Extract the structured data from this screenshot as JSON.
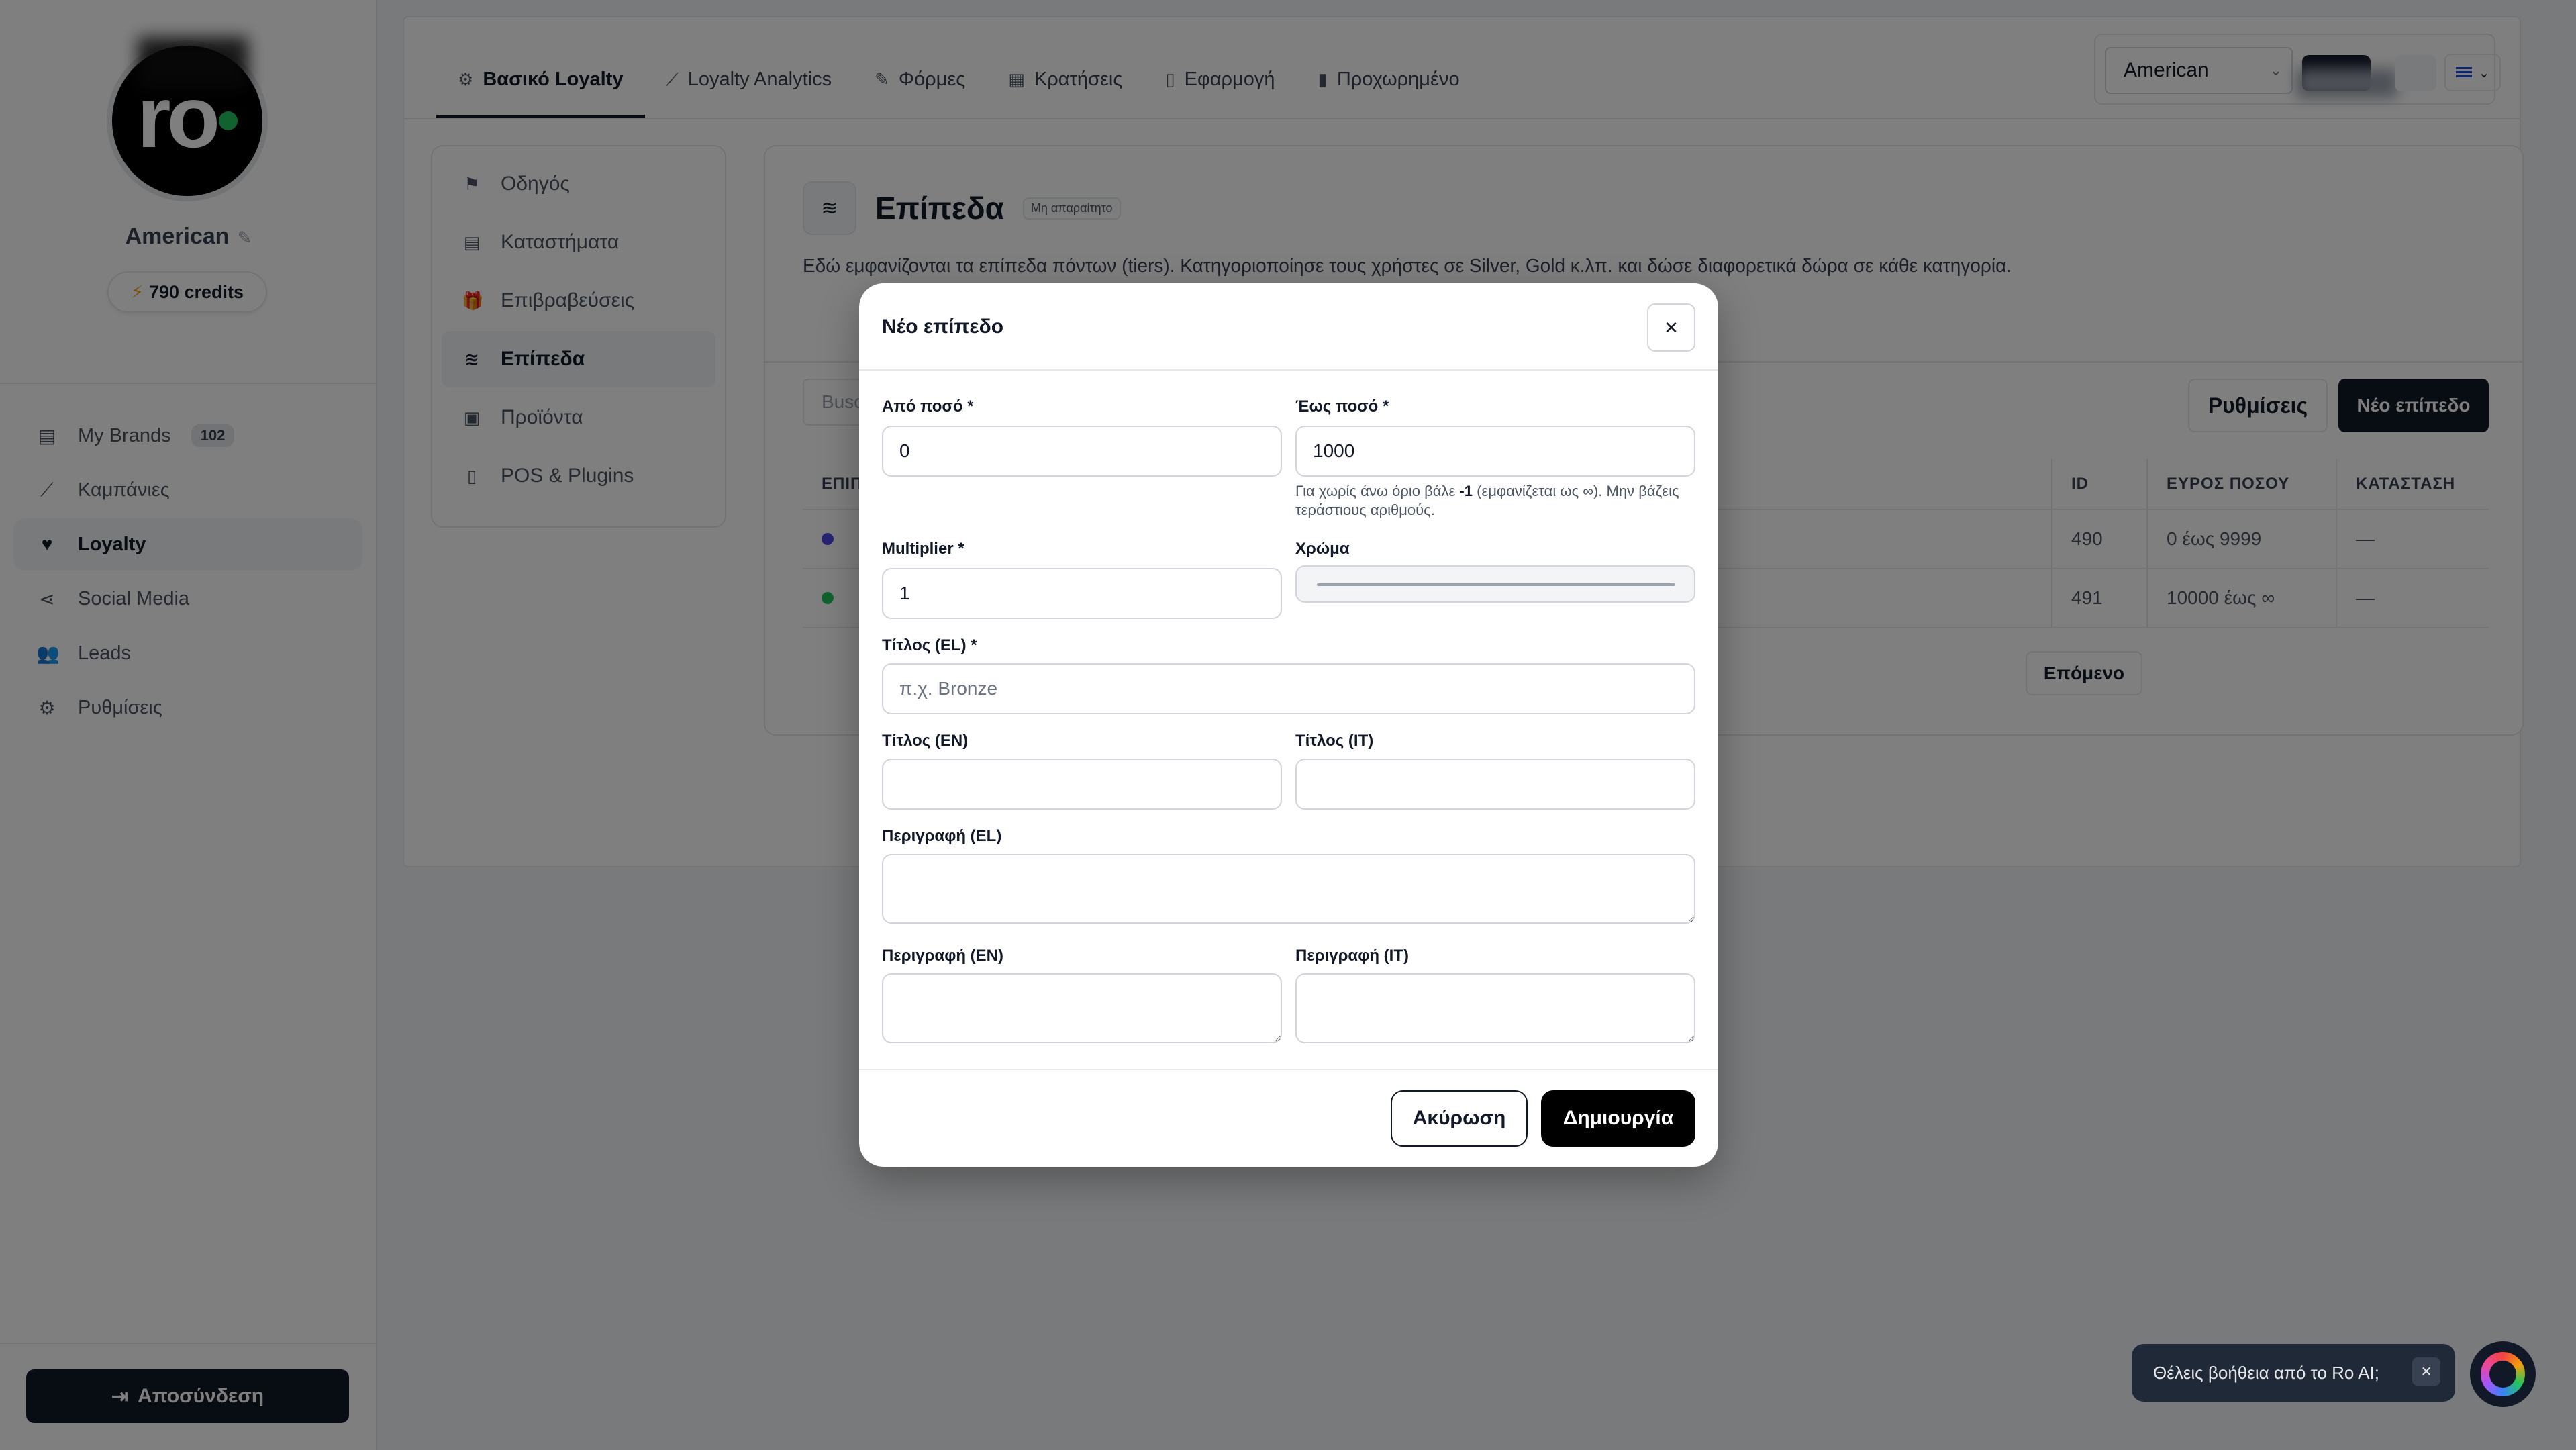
{
  "sidebar": {
    "avatar_text": "ro",
    "brand_name": "American",
    "credits": "790 credits",
    "nav": [
      {
        "label": "My Brands",
        "icon": "store-icon",
        "badge": "102"
      },
      {
        "label": "Καμπάνιες",
        "icon": "chart-line-icon"
      },
      {
        "label": "Loyalty",
        "icon": "heart-icon"
      },
      {
        "label": "Social Media",
        "icon": "share-icon"
      },
      {
        "label": "Leads",
        "icon": "users-icon"
      },
      {
        "label": "Ρυθμίσεις",
        "icon": "gear-icon"
      }
    ],
    "logout_label": "Αποσύνδεση"
  },
  "tabs": [
    {
      "label": "Βασικό Loyalty",
      "icon": "gears-icon"
    },
    {
      "label": "Loyalty Analytics",
      "icon": "chart-line-icon"
    },
    {
      "label": "Φόρμες",
      "icon": "edit-icon"
    },
    {
      "label": "Κρατήσεις",
      "icon": "calendar-icon"
    },
    {
      "label": "Εφαρμογή",
      "icon": "phone-icon"
    },
    {
      "label": "Προχωρημένο",
      "icon": "book-icon"
    }
  ],
  "top_controls": {
    "brand_select_value": "American"
  },
  "inner_nav": [
    {
      "label": "Οδηγός",
      "icon": "signpost-icon"
    },
    {
      "label": "Καταστήματα",
      "icon": "store-icon"
    },
    {
      "label": "Επιβραβεύσεις",
      "icon": "gift-icon"
    },
    {
      "label": "Επίπεδα",
      "icon": "layers-icon"
    },
    {
      "label": "Προϊόντα",
      "icon": "bag-icon"
    },
    {
      "label": "POS & Plugins",
      "icon": "tablet-icon"
    }
  ],
  "section": {
    "title": "Επίπεδα",
    "badge": "Μη απαραίτητο",
    "description": "Εδώ εμφανίζονται τα επίπεδα πόντων (tiers). Κατηγοριοποίησε τους χρήστες σε Silver, Gold κ.λπ. και δώσε διαφορετικά δώρα σε κάθε κατηγορία.",
    "search_placeholder": "Busc",
    "settings_label": "Ρυθμίσεις",
    "new_label": "Νέο επίπεδο",
    "next_label": "Επόμενο"
  },
  "table": {
    "headers": {
      "level": "ΕΠΙΠ",
      "id": "ID",
      "range": "ΕΥΡΟΣ ΠΟΣΟΥ",
      "status": "ΚΑΤΑΣΤΑΣΗ"
    },
    "rows": [
      {
        "color": "#4f46e5",
        "id": "490",
        "range": "0 έως 9999",
        "status": "—"
      },
      {
        "color": "#22c55e",
        "id": "491",
        "range": "10000 έως ∞",
        "status": "—"
      }
    ]
  },
  "modal": {
    "title": "Νέο επίπεδο",
    "from_label": "Από ποσό *",
    "from_value": "0",
    "to_label": "Έως ποσό *",
    "to_value": "1000",
    "hint_pre": "Για χωρίς άνω όριο βάλε ",
    "hint_bold": "-1",
    "hint_post": " (εμφανίζεται ως ∞). Μην βάζεις τεράστιους αριθμούς.",
    "multiplier_label": "Multiplier *",
    "multiplier_value": "1",
    "color_label": "Χρώμα",
    "title_el_label": "Τίτλος (EL) *",
    "title_el_placeholder": "π.χ. Bronze",
    "title_en_label": "Τίτλος (EN)",
    "title_it_label": "Τίτλος (IT)",
    "desc_el_label": "Περιγραφή (EL)",
    "desc_en_label": "Περιγραφή (EN)",
    "desc_it_label": "Περιγραφή (IT)",
    "cancel_label": "Ακύρωση",
    "create_label": "Δημιουργία"
  },
  "ai_widget": {
    "text": "Θέλεις βοήθεια από το Ro AI;"
  }
}
